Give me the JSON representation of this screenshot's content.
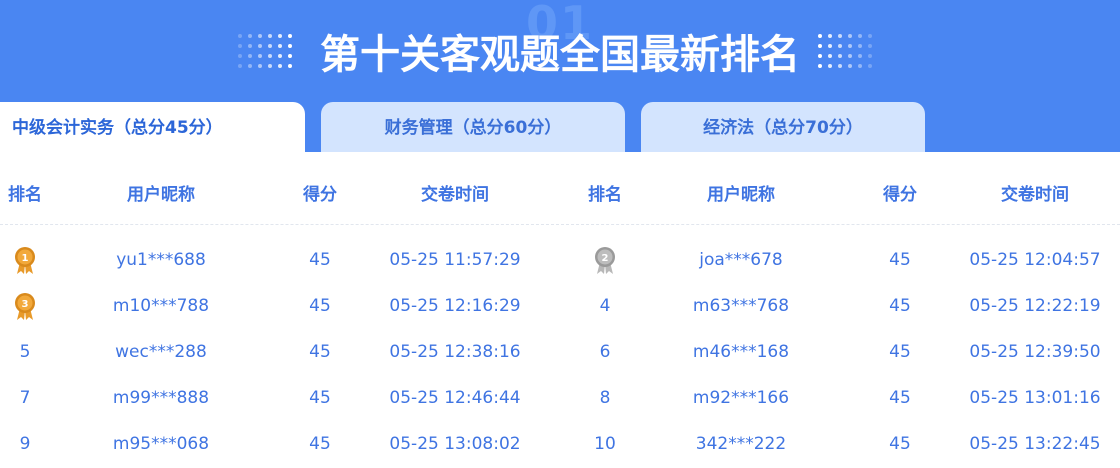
{
  "banner": {
    "background_number": "01",
    "title": "第十关客观题全国最新排名",
    "color": "#4a86f2"
  },
  "tabs": [
    {
      "label": "中级会计实务（总分45分）",
      "active": true
    },
    {
      "label": "财务管理（总分60分）",
      "active": false
    },
    {
      "label": "经济法（总分70分）",
      "active": false
    }
  ],
  "table": {
    "headers": {
      "rank": "排名",
      "nickname": "用户昵称",
      "score": "得分",
      "time": "交卷时间"
    },
    "rows": [
      {
        "left": {
          "rank": "1",
          "rank_icon": "gold-medal-1-icon",
          "nickname": "yu1***688",
          "score": "45",
          "time": "05-25 11:57:29"
        },
        "right": {
          "rank": "2",
          "rank_icon": "silver-medal-2-icon",
          "nickname": "joa***678",
          "score": "45",
          "time": "05-25 12:04:57"
        }
      },
      {
        "left": {
          "rank": "3",
          "rank_icon": "bronze-medal-3-icon",
          "nickname": "m10***788",
          "score": "45",
          "time": "05-25 12:16:29"
        },
        "right": {
          "rank": "4",
          "nickname": "m63***768",
          "score": "45",
          "time": "05-25 12:22:19"
        }
      },
      {
        "left": {
          "rank": "5",
          "nickname": "wec***288",
          "score": "45",
          "time": "05-25 12:38:16"
        },
        "right": {
          "rank": "6",
          "nickname": "m46***168",
          "score": "45",
          "time": "05-25 12:39:50"
        }
      },
      {
        "left": {
          "rank": "7",
          "nickname": "m99***888",
          "score": "45",
          "time": "05-25 12:46:44"
        },
        "right": {
          "rank": "8",
          "nickname": "m92***166",
          "score": "45",
          "time": "05-25 13:01:16"
        }
      },
      {
        "left": {
          "rank": "9",
          "nickname": "m95***068",
          "score": "45",
          "time": "05-25 13:08:02"
        },
        "right": {
          "rank": "10",
          "nickname": "342***222",
          "score": "45",
          "time": "05-25 13:22:45"
        }
      }
    ]
  },
  "colors": {
    "accent": "#3f74e2",
    "tab_inactive_bg": "#d3e4fe",
    "gold": "#f2a93b",
    "silver": "#bdbdbd"
  }
}
